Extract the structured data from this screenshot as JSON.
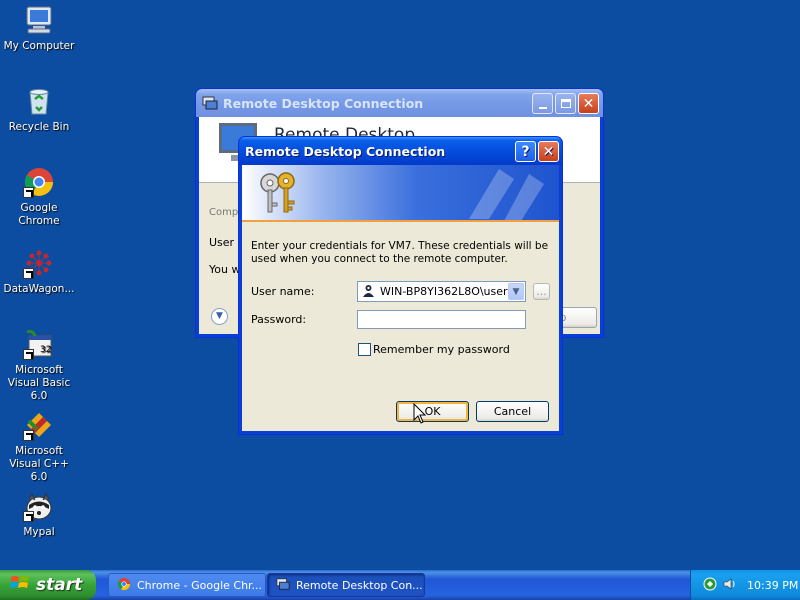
{
  "desktop": {
    "icons": [
      {
        "label": "My Computer",
        "icon": "my-computer-icon"
      },
      {
        "label": "Recycle Bin",
        "icon": "recycle-bin-icon"
      },
      {
        "label": "Google Chrome",
        "icon": "chrome-icon"
      },
      {
        "label": "DataWagon...",
        "icon": "datawagon-icon"
      },
      {
        "label": "Microsoft Visual Basic 6.0",
        "icon": "visual-basic-icon"
      },
      {
        "label": "Microsoft Visual C++ 6.0",
        "icon": "visual-cpp-icon"
      },
      {
        "label": "Mypal",
        "icon": "mypal-icon"
      }
    ]
  },
  "bg_window": {
    "title": "Remote Desktop Connection",
    "header_text": "Remote Desktop",
    "frag_computer": "Comp",
    "frag_user": "User n",
    "frag_you": "You w",
    "frag_button": "p"
  },
  "dialog": {
    "title": "Remote Desktop Connection",
    "help_button": "?",
    "close_button": "✕",
    "instruction": "Enter your credentials for VM7. These credentials will be used when you connect to the remote computer.",
    "username_label": "User name:",
    "username_value": "WIN-BP8YI362L8O\\user",
    "browse_button": "...",
    "password_label": "Password:",
    "password_value": "",
    "remember_label": "Remember my password",
    "remember_checked": false,
    "ok_label": "OK",
    "cancel_label": "Cancel"
  },
  "taskbar": {
    "start_label": "start",
    "items": [
      {
        "label": "Chrome - Google Chr...",
        "icon": "chrome-icon",
        "active": false
      },
      {
        "label": "Remote Desktop Con...",
        "icon": "remote-desktop-icon",
        "active": true
      }
    ],
    "clock": "10:39 PM"
  },
  "colors": {
    "desktop": "#0d4da1",
    "titlebar": "#0450e0",
    "dialog_face": "#ece9d8",
    "start_green": "#37a337"
  }
}
